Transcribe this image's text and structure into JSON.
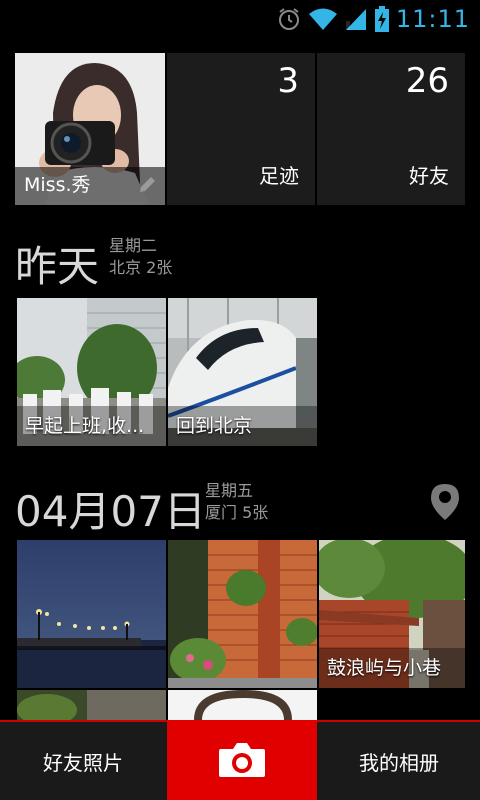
{
  "status_bar": {
    "time": "11:11",
    "icons": [
      "alarm-icon",
      "wifi-icon",
      "signal-icon",
      "battery-charging-icon"
    ],
    "accent_color": "#33b5e5"
  },
  "profile": {
    "name": "Miss.秀",
    "stats": [
      {
        "count": "3",
        "label": "足迹"
      },
      {
        "count": "26",
        "label": "好友"
      }
    ]
  },
  "groups": [
    {
      "date": "昨天",
      "weekday": "星期二",
      "summary": "北京 2张",
      "photos": [
        {
          "caption": "早起上班,收..."
        },
        {
          "caption": "回到北京"
        }
      ]
    },
    {
      "date": "04月07日",
      "weekday": "星期五",
      "summary": "厦门 5张",
      "photos": [
        {
          "caption": ""
        },
        {
          "caption": ""
        },
        {
          "caption": "鼓浪屿与小巷"
        }
      ]
    }
  ],
  "bottom_bar": {
    "left_label": "好友照片",
    "right_label": "我的相册",
    "camera_icon": "camera-icon",
    "camera_color": "#e00000"
  }
}
